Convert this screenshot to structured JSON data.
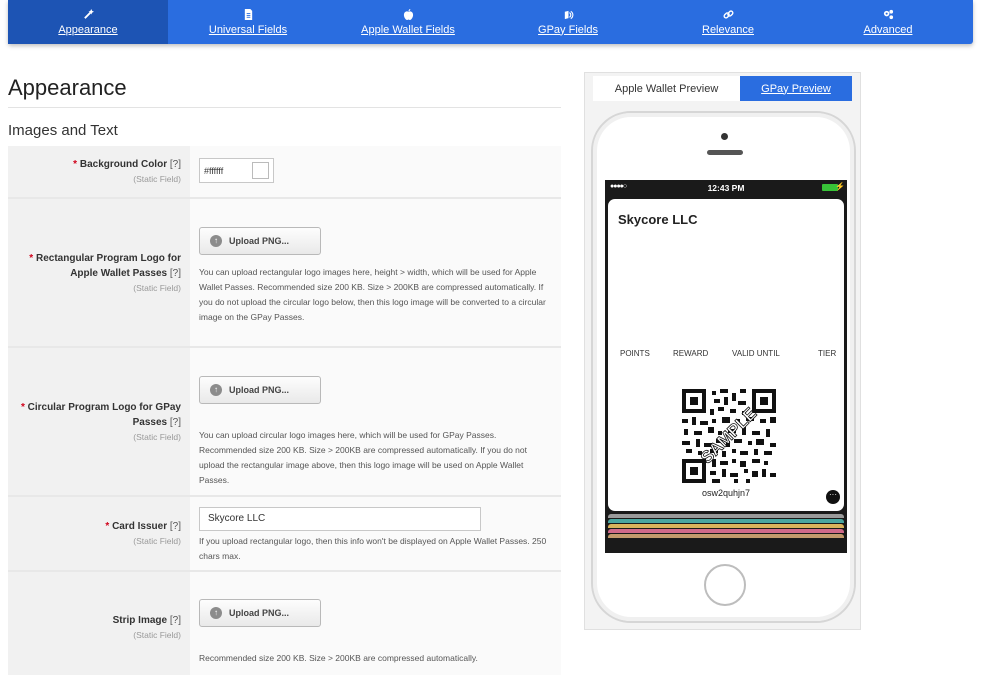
{
  "nav": {
    "tabs": [
      {
        "label": "Appearance",
        "icon": "magic-wand-icon"
      },
      {
        "label": "Universal Fields",
        "icon": "document-icon"
      },
      {
        "label": "Apple Wallet Fields",
        "icon": "apple-icon"
      },
      {
        "label": "GPay Fields",
        "icon": "gpay-icon"
      },
      {
        "label": "Relevance",
        "icon": "link-icon"
      },
      {
        "label": "Advanced",
        "icon": "gears-icon"
      }
    ],
    "active_index": 0
  },
  "page": {
    "title": "Appearance",
    "section_title": "Images and Text"
  },
  "form": {
    "required_mark": "*",
    "help_mark": "[?]",
    "static_label": "(Static Field)",
    "upload_label": "Upload PNG...",
    "fields": {
      "background_color": {
        "label": "Background Color",
        "value": "#ffffff"
      },
      "rect_logo": {
        "label": "Rectangular Program Logo for Apple Wallet Passes",
        "description": "You can upload rectangular logo images here, height > width, which will be used for Apple Wallet Passes. Recommended size 200 KB. Size > 200KB are compressed automatically. If you do not upload the circular logo below, then this logo image will be converted to a circular image on the GPay Passes."
      },
      "circ_logo": {
        "label": "Circular Program Logo for GPay Passes",
        "description": "You can upload circular logo images here, which will be used for GPay Passes. Recommended size 200 KB. Size > 200KB are compressed automatically. If you do not upload the rectangular image above, then this logo image will be used on Apple Wallet Passes."
      },
      "card_issuer": {
        "label": "Card Issuer",
        "value": "Skycore LLC",
        "description": "If you upload rectangular logo, then this info won't be displayed on Apple Wallet Passes. 250 chars max."
      },
      "strip_image": {
        "label": "Strip Image",
        "description": "Recommended size 200 KB. Size > 200KB are compressed automatically."
      }
    }
  },
  "preview": {
    "tabs": [
      "Apple Wallet Preview",
      "GPay Preview"
    ],
    "phone": {
      "time": "12:43 PM",
      "signal": "●●●●○",
      "card": {
        "org": "Skycore LLC",
        "fields": [
          "POINTS",
          "REWARD",
          "VALID UNTIL",
          "TIER"
        ],
        "watermark": "SAMPLE",
        "barcode_text": "osw2quhjn7"
      },
      "stack_colors": [
        "#9a9a9a",
        "#4aa6a0",
        "#d9b35c",
        "#d16a8a",
        "#c49a6c"
      ]
    }
  },
  "colors": {
    "nav_blue": "#2a6de0",
    "nav_active": "#1d54b4",
    "required_red": "#d0021b"
  }
}
